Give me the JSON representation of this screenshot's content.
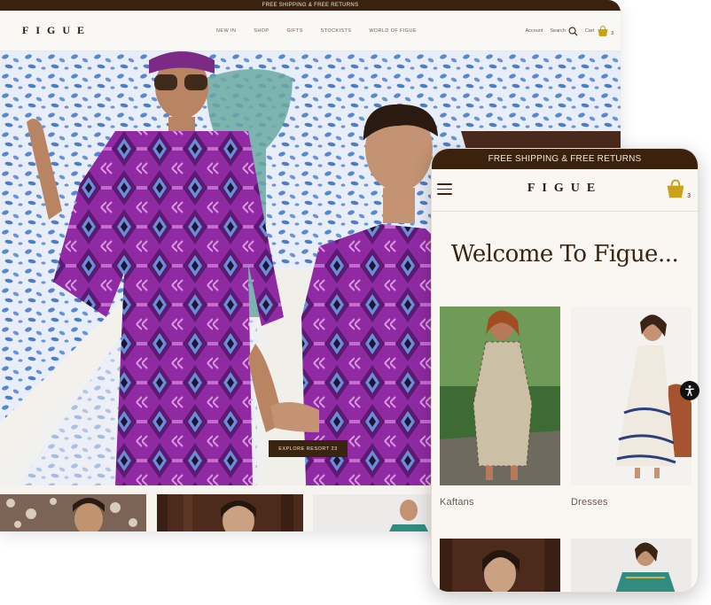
{
  "desktop": {
    "announcement": "FREE SHIPPING & FREE RETURNS",
    "logo": "FIGUE",
    "nav": [
      "NEW IN",
      "SHOP",
      "GIFTS",
      "STOCKISTS",
      "WORLD OF FIGUE"
    ],
    "account_label": "Account",
    "search_label": "Search",
    "cart_label": "Cart",
    "cart_count": "3",
    "hero_cta": "EXPLORE RESORT 23"
  },
  "mobile": {
    "announcement": "FREE SHIPPING & FREE RETURNS",
    "logo": "FIGUE",
    "cart_count": "3",
    "welcome": "Welcome To Figue...",
    "categories": [
      {
        "label": "Kaftans"
      },
      {
        "label": "Dresses"
      }
    ]
  },
  "colors": {
    "brand_dark": "#3a220f",
    "cart_gold": "#c9a21a",
    "background": "#faf7f3"
  },
  "icons": {
    "search": "search-icon",
    "cart": "shopping-bag-icon",
    "menu": "hamburger-menu-icon",
    "accessibility": "accessibility-icon"
  }
}
